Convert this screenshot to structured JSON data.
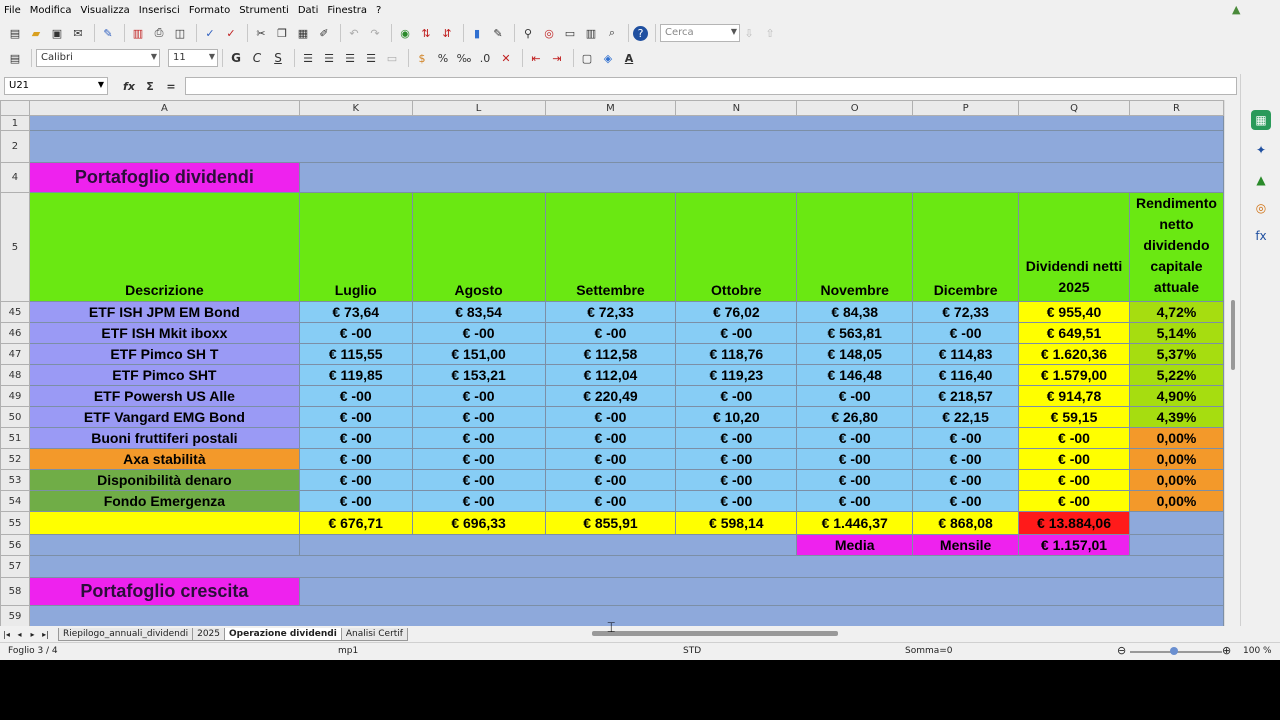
{
  "menu": [
    "File",
    "Modifica",
    "Visualizza",
    "Inserisci",
    "Formato",
    "Strumenti",
    "Dati",
    "Finestra",
    "?"
  ],
  "toolbar": {
    "search_placeholder": "Cerca",
    "font_name": "Calibri",
    "font_size": "11",
    "bold_label": "G",
    "italic_label": "C",
    "underline_label": "S"
  },
  "formula_bar": {
    "cell_ref": "U21",
    "func_label": "fx",
    "sum_label": "Σ",
    "eq_label": "=",
    "content": ""
  },
  "columns": [
    "A",
    "K",
    "L",
    "M",
    "N",
    "O",
    "P",
    "Q",
    "R"
  ],
  "sheet": {
    "title_dividendi": "Portafoglio dividendi",
    "title_crescita": "Portafoglio crescita",
    "header": {
      "desc": "Descrizione",
      "months": [
        "Luglio",
        "Agosto",
        "Settembre",
        "Ottobre",
        "Novembre",
        "Dicembre"
      ],
      "netti": "Dividendi netti 2025",
      "rendimento": "Rendimento netto dividendo capitale attuale"
    },
    "rows": [
      {
        "num": "45",
        "desc": "ETF ISH JPM EM Bond",
        "vals": [
          "€ 73,64",
          "€ 83,54",
          "€ 72,33",
          "€ 76,02",
          "€ 84,38",
          "€ 72,33"
        ],
        "total": "€ 955,40",
        "rend": "4,72%"
      },
      {
        "num": "46",
        "desc": "ETF ISH Mkit iboxx",
        "vals": [
          "€ -00",
          "€ -00",
          "€ -00",
          "€ -00",
          "€ 563,81",
          "€ -00"
        ],
        "total": "€ 649,51",
        "rend": "5,14%"
      },
      {
        "num": "47",
        "desc": "ETF Pimco SH T",
        "vals": [
          "€ 115,55",
          "€ 151,00",
          "€ 112,58",
          "€ 118,76",
          "€ 148,05",
          "€ 114,83"
        ],
        "total": "€ 1.620,36",
        "rend": "5,37%"
      },
      {
        "num": "48",
        "desc": "ETF Pimco SHT",
        "vals": [
          "€ 119,85",
          "€ 153,21",
          "€ 112,04",
          "€ 119,23",
          "€ 146,48",
          "€ 116,40"
        ],
        "total": "€ 1.579,00",
        "rend": "5,22%"
      },
      {
        "num": "49",
        "desc": "ETF Powersh US Alle",
        "vals": [
          "€ -00",
          "€ -00",
          "€ 220,49",
          "€ -00",
          "€ -00",
          "€ 218,57"
        ],
        "total": "€ 914,78",
        "rend": "4,90%"
      },
      {
        "num": "50",
        "desc": "ETF Vangard EMG Bond",
        "vals": [
          "€ -00",
          "€ -00",
          "€ -00",
          "€ 10,20",
          "€ 26,80",
          "€ 22,15"
        ],
        "total": "€ 59,15",
        "rend": "4,39%"
      },
      {
        "num": "51",
        "desc": "Buoni fruttiferi postali",
        "vals": [
          "€ -00",
          "€ -00",
          "€ -00",
          "€ -00",
          "€ -00",
          "€ -00"
        ],
        "total": "€ -00",
        "rend": "0,00%"
      },
      {
        "num": "52",
        "desc": "Axa stabilità",
        "vals": [
          "€ -00",
          "€ -00",
          "€ -00",
          "€ -00",
          "€ -00",
          "€ -00"
        ],
        "total": "€ -00",
        "rend": "0,00%"
      },
      {
        "num": "53",
        "desc": "Disponibilità denaro",
        "vals": [
          "€ -00",
          "€ -00",
          "€ -00",
          "€ -00",
          "€ -00",
          "€ -00"
        ],
        "total": "€ -00",
        "rend": "0,00%"
      },
      {
        "num": "54",
        "desc": "Fondo Emergenza",
        "vals": [
          "€ -00",
          "€ -00",
          "€ -00",
          "€ -00",
          "€ -00",
          "€ -00"
        ],
        "total": "€ -00",
        "rend": "0,00%"
      }
    ],
    "totals": {
      "num": "55",
      "vals": [
        "€ 676,71",
        "€ 696,33",
        "€ 855,91",
        "€ 598,14",
        "€ 1.446,37",
        "€ 868,08"
      ],
      "grand": "€ 13.884,06"
    },
    "media": {
      "num": "56",
      "label1": "Media",
      "label2": "Mensile",
      "value": "€ 1.157,01"
    },
    "row_nums": {
      "r1": "1",
      "r2": "2",
      "r4": "4",
      "r5": "5",
      "r57": "57",
      "r58": "58",
      "r59": "59"
    }
  },
  "tabs": [
    "Riepilogo_annuali_dividendi",
    "2025",
    "Operazione dividendi",
    "Analisi Certif"
  ],
  "status": {
    "sheet": "Foglio 3 / 4",
    "style": "mp1",
    "mode": "STD",
    "sum": "Somma=0",
    "zoom": "100 %"
  },
  "colors": {
    "grid_bg": "#8ea9db",
    "header_green": "#6ae812",
    "month_blue": "#87cdf5",
    "desc_lavender": "#9a9af5",
    "total_yellow": "#ffff00",
    "title_magenta": "#ee22ee",
    "grand_red": "#ff1a1a"
  }
}
